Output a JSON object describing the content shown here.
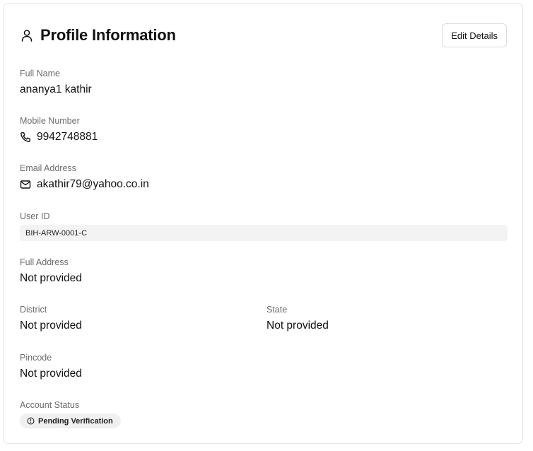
{
  "header": {
    "title": "Profile Information",
    "edit_label": "Edit Details",
    "icon": "user-icon"
  },
  "fields": {
    "full_name": {
      "label": "Full Name",
      "value": "ananya1 kathir"
    },
    "mobile": {
      "label": "Mobile Number",
      "value": "9942748881",
      "icon": "phone-icon"
    },
    "email": {
      "label": "Email Address",
      "value": "akathir79@yahoo.co.in",
      "icon": "mail-icon"
    },
    "user_id": {
      "label": "User ID",
      "value": "BIH-ARW-0001-C"
    },
    "address": {
      "label": "Full Address",
      "value": "Not provided"
    },
    "district": {
      "label": "District",
      "value": "Not provided"
    },
    "state": {
      "label": "State",
      "value": "Not provided"
    },
    "pincode": {
      "label": "Pincode",
      "value": "Not provided"
    },
    "status": {
      "label": "Account Status",
      "value": "Pending Verification",
      "icon": "clock-icon"
    }
  }
}
